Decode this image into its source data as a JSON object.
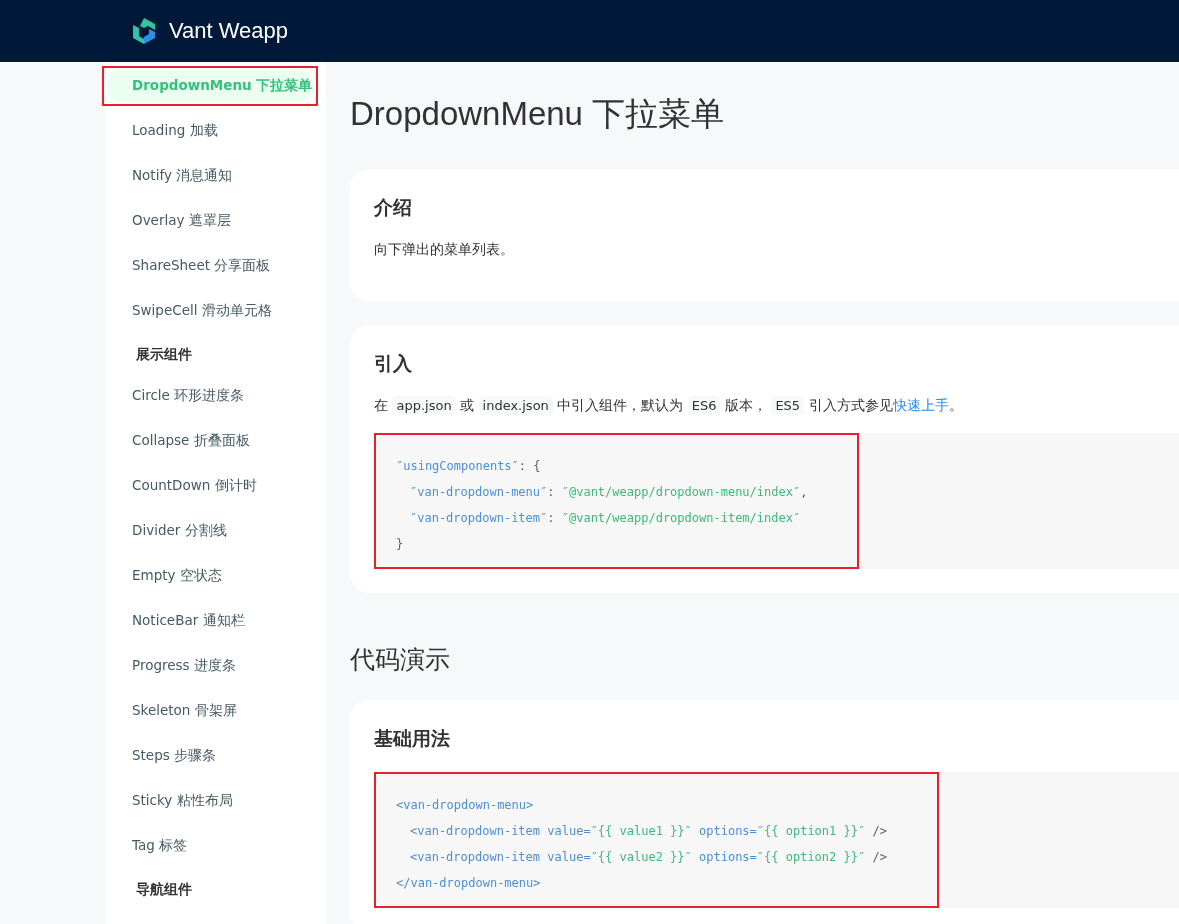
{
  "header": {
    "brand": "Vant Weapp"
  },
  "sidebar": {
    "items": [
      {
        "kind": "link",
        "label": "DropdownMenu 下拉菜单",
        "selected": true,
        "highlighted": true
      },
      {
        "kind": "link",
        "label": "Loading 加载",
        "selected": false,
        "highlighted": false
      },
      {
        "kind": "link",
        "label": "Notify 消息通知",
        "selected": false,
        "highlighted": false
      },
      {
        "kind": "link",
        "label": "Overlay 遮罩层",
        "selected": false,
        "highlighted": false
      },
      {
        "kind": "link",
        "label": "ShareSheet 分享面板",
        "selected": false,
        "highlighted": false
      },
      {
        "kind": "link",
        "label": "SwipeCell 滑动单元格",
        "selected": false,
        "highlighted": false
      },
      {
        "kind": "group",
        "label": "展示组件"
      },
      {
        "kind": "link",
        "label": "Circle 环形进度条",
        "selected": false,
        "highlighted": false
      },
      {
        "kind": "link",
        "label": "Collapse 折叠面板",
        "selected": false,
        "highlighted": false
      },
      {
        "kind": "link",
        "label": "CountDown 倒计时",
        "selected": false,
        "highlighted": false
      },
      {
        "kind": "link",
        "label": "Divider 分割线",
        "selected": false,
        "highlighted": false
      },
      {
        "kind": "link",
        "label": "Empty 空状态",
        "selected": false,
        "highlighted": false
      },
      {
        "kind": "link",
        "label": "NoticeBar 通知栏",
        "selected": false,
        "highlighted": false
      },
      {
        "kind": "link",
        "label": "Progress 进度条",
        "selected": false,
        "highlighted": false
      },
      {
        "kind": "link",
        "label": "Skeleton 骨架屏",
        "selected": false,
        "highlighted": false
      },
      {
        "kind": "link",
        "label": "Steps 步骤条",
        "selected": false,
        "highlighted": false
      },
      {
        "kind": "link",
        "label": "Sticky 粘性布局",
        "selected": false,
        "highlighted": false
      },
      {
        "kind": "link",
        "label": "Tag 标签",
        "selected": false,
        "highlighted": false
      },
      {
        "kind": "group",
        "label": "导航组件"
      }
    ]
  },
  "content": {
    "title": "DropdownMenu 下拉菜单",
    "blocks": [
      {
        "kind": "card",
        "heading": "介绍",
        "paragraph": [
          {
            "kind": "text",
            "text": "向下弹出的菜单列表。"
          }
        ]
      },
      {
        "kind": "card",
        "heading": "引入",
        "paragraph": [
          {
            "kind": "text",
            "text": "在 "
          },
          {
            "kind": "code",
            "text": "app.json"
          },
          {
            "kind": "text",
            "text": " 或 "
          },
          {
            "kind": "code",
            "text": "index.json"
          },
          {
            "kind": "text",
            "text": " 中引入组件，默认为 "
          },
          {
            "kind": "code",
            "text": "ES6"
          },
          {
            "kind": "text",
            "text": " 版本， "
          },
          {
            "kind": "code",
            "text": "ES5"
          },
          {
            "kind": "text",
            "text": " 引入方式参见"
          },
          {
            "kind": "link",
            "text": "快速上手"
          },
          {
            "kind": "text",
            "text": "。"
          }
        ],
        "code": {
          "highlighted": true,
          "lines": [
            {
              "indented": false,
              "tokens": [
                {
                  "kind": "key",
                  "text": "″usingComponents″"
                },
                {
                  "kind": "punct",
                  "text": ": {"
                }
              ]
            },
            {
              "indented": true,
              "tokens": [
                {
                  "kind": "key",
                  "text": "″van-dropdown-menu″"
                },
                {
                  "kind": "punct",
                  "text": ": "
                },
                {
                  "kind": "string",
                  "text": "″@vant/weapp/dropdown-menu/index″"
                },
                {
                  "kind": "punct",
                  "text": ","
                }
              ]
            },
            {
              "indented": true,
              "tokens": [
                {
                  "kind": "key",
                  "text": "″van-dropdown-item″"
                },
                {
                  "kind": "punct",
                  "text": ": "
                },
                {
                  "kind": "string",
                  "text": "″@vant/weapp/dropdown-item/index″"
                }
              ]
            },
            {
              "indented": false,
              "tokens": [
                {
                  "kind": "punct",
                  "text": "}"
                }
              ]
            }
          ]
        }
      },
      {
        "kind": "section",
        "heading": "代码演示"
      },
      {
        "kind": "card",
        "heading": "基础用法",
        "code": {
          "highlighted": true,
          "lines": [
            {
              "indented": false,
              "tokens": [
                {
                  "kind": "key",
                  "text": "<van-dropdown-menu>"
                }
              ]
            },
            {
              "indented": true,
              "tokens": [
                {
                  "kind": "key",
                  "text": "<van-dropdown-item value="
                },
                {
                  "kind": "string",
                  "text": "″{{ value1 }}″"
                },
                {
                  "kind": "key",
                  "text": " options="
                },
                {
                  "kind": "string",
                  "text": "″{{ option1 }}″"
                },
                {
                  "kind": "punct",
                  "text": " />"
                }
              ]
            },
            {
              "indented": true,
              "tokens": [
                {
                  "kind": "key",
                  "text": "<van-dropdown-item value="
                },
                {
                  "kind": "string",
                  "text": "″{{ value2 }}″"
                },
                {
                  "kind": "key",
                  "text": " options="
                },
                {
                  "kind": "string",
                  "text": "″{{ option2 }}″"
                },
                {
                  "kind": "punct",
                  "text": " />"
                }
              ]
            },
            {
              "indented": false,
              "tokens": [
                {
                  "kind": "key",
                  "text": "</van-dropdown-menu>"
                }
              ]
            }
          ]
        }
      }
    ]
  }
}
